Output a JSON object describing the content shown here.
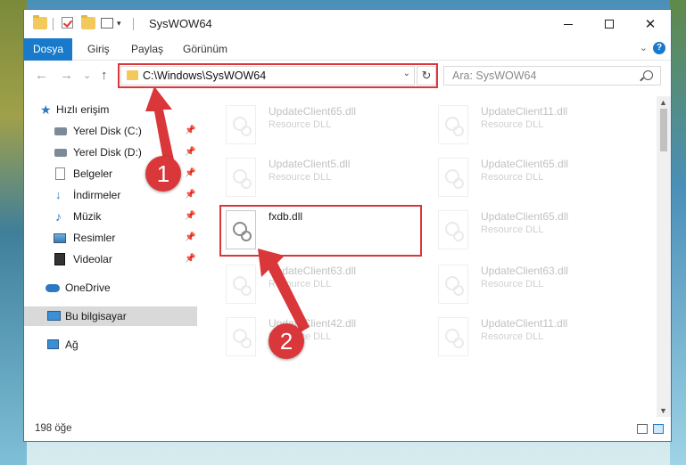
{
  "window": {
    "title": "SysWOW64",
    "controls": {
      "minimize": "",
      "maximize": "",
      "close": "✕"
    }
  },
  "ribbon": {
    "tabs": [
      {
        "label": "Dosya"
      },
      {
        "label": "Giriş"
      },
      {
        "label": "Paylaş"
      },
      {
        "label": "Görünüm"
      }
    ],
    "help": "?"
  },
  "navbar": {
    "back": "←",
    "forward": "→",
    "recent": "⌄",
    "up": "↑",
    "address": "C:\\Windows\\SysWOW64",
    "refresh": "↻",
    "search_placeholder": "Ara: SysWOW64"
  },
  "sidebar": {
    "items": [
      {
        "label": "Hızlı erişim",
        "icon": "star-icon"
      },
      {
        "label": "Yerel Disk (C:)",
        "icon": "disk-icon",
        "pinned": true
      },
      {
        "label": "Yerel Disk (D:)",
        "icon": "disk-icon",
        "pinned": true
      },
      {
        "label": "Belgeler",
        "icon": "document-icon",
        "pinned": true
      },
      {
        "label": "İndirmeler",
        "icon": "download-icon",
        "pinned": true
      },
      {
        "label": "Müzik",
        "icon": "music-icon",
        "pinned": true
      },
      {
        "label": "Resimler",
        "icon": "pictures-icon",
        "pinned": true
      },
      {
        "label": "Videolar",
        "icon": "video-icon",
        "pinned": true
      },
      {
        "label": "OneDrive",
        "icon": "cloud-icon"
      },
      {
        "label": "Bu bilgisayar",
        "icon": "computer-icon",
        "selected": true
      },
      {
        "label": "Ağ",
        "icon": "network-icon"
      }
    ]
  },
  "files": [
    {
      "name": "UpdateClient65.dll",
      "type": "Resource DLL"
    },
    {
      "name": "UpdateClient11.dll",
      "type": "Resource DLL"
    },
    {
      "name": "UpdateClient5.dll",
      "type": "Resource DLL"
    },
    {
      "name": "UpdateClient65.dll",
      "type": "Resource DLL"
    },
    {
      "name": "fxdb.dll",
      "type": ""
    },
    {
      "name": "UpdateClient65.dll",
      "type": "Resource DLL"
    },
    {
      "name": "UpdateClient63.dll",
      "type": "Resource DLL"
    },
    {
      "name": "UpdateClient63.dll",
      "type": "Resource DLL"
    },
    {
      "name": "UpdateClient42.dll",
      "type": "Resource DLL"
    },
    {
      "name": "UpdateClient11.dll",
      "type": "Resource DLL"
    }
  ],
  "status": {
    "count": "198 öğe"
  },
  "annotations": {
    "step1": "1",
    "step2": "2",
    "color": "#d9373a"
  }
}
